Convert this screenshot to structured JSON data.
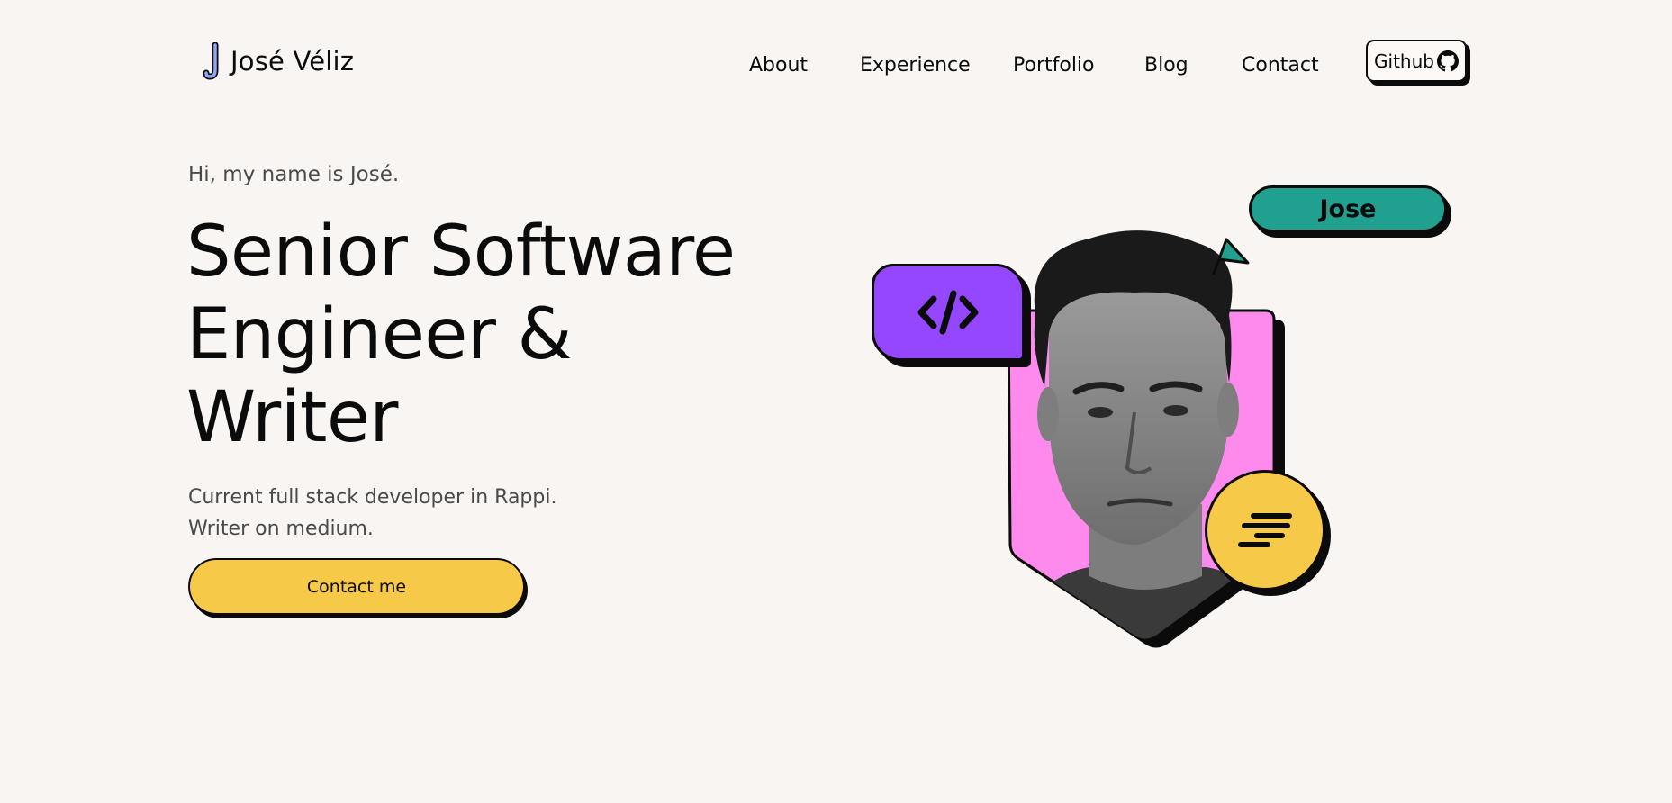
{
  "header": {
    "brand": "José Véliz",
    "nav": [
      "About",
      "Experience",
      "Portfolio",
      "Blog",
      "Contact"
    ],
    "github_label": "Github"
  },
  "hero": {
    "greeting": "Hi, my name is José.",
    "headline": [
      "Senior Software",
      "Engineer &",
      "Writer"
    ],
    "subtitle": [
      "Current full stack developer in Rappi.",
      "Writer on medium."
    ],
    "cta_label": "Contact me"
  },
  "illustration": {
    "name_tag": "Jose",
    "icons": [
      "code-icon",
      "cursor-arrow-icon",
      "medium-icon",
      "portrait-photo"
    ],
    "colors": {
      "background": "#f9f5f2",
      "photo_backdrop": "#ff8aee",
      "code_badge": "#9447ff",
      "name_tag": "#21a090",
      "accent_yellow": "#f7c948",
      "outline": "#0b0b0b"
    }
  }
}
